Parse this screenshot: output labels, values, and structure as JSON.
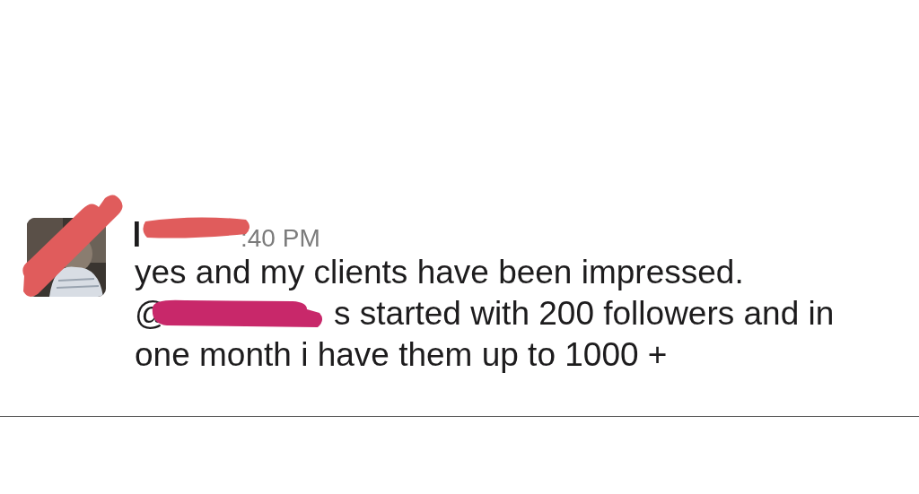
{
  "message": {
    "author": {
      "redacted": true
    },
    "timestamp": ":40 PM",
    "lines": [
      {
        "kind": "plain",
        "text": "yes and my clients have been impressed."
      },
      {
        "kind": "mention",
        "prefix": "@",
        "redacted": true,
        "text": "s started with 200 followers and in"
      },
      {
        "kind": "plain",
        "text": "one month i have them up to 1000 +"
      }
    ]
  }
}
